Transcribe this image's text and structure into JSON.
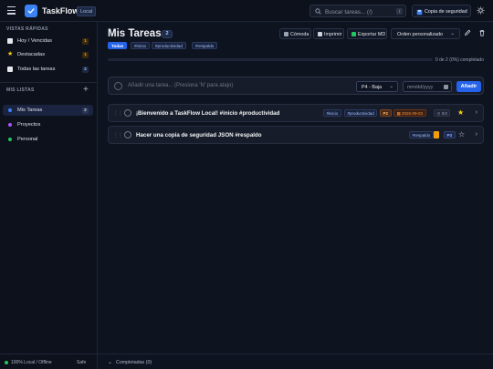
{
  "app": {
    "name": "TaskFlow",
    "badge": "Local"
  },
  "search": {
    "placeholder": "Buscar tareas... (/)",
    "shortcut": "/"
  },
  "header_actions": {
    "backup_label": "Copia de seguridad",
    "theme_icon": "sun-icon"
  },
  "sidebar": {
    "quick_views_title": "VISTAS RÁPIDAS",
    "quick_views": [
      {
        "label": "Hoy / Vencidas",
        "count": "1",
        "icon": "calendar-icon",
        "count_color": "#f59e0b"
      },
      {
        "label": "Destacadas",
        "count": "1",
        "icon": "star-icon",
        "count_color": "#f59e0b"
      },
      {
        "label": "Todas las tareas",
        "count": "2",
        "icon": "clipboard-icon",
        "count_color": "#3b82f6"
      }
    ],
    "lists_title": "MIS LISTAS",
    "lists": [
      {
        "label": "Mis Tareas",
        "count": "2",
        "color": "#3b82f6",
        "active": true
      },
      {
        "label": "Proyectos",
        "color": "#a855f7"
      },
      {
        "label": "Personal",
        "color": "#22c55e"
      }
    ],
    "footer_status": "100% Local / Offline",
    "footer_safe": "Safe"
  },
  "main": {
    "title": "Mis Tareas",
    "count": "2",
    "toolbar": {
      "density": "Cómoda",
      "print": "Imprimir",
      "export": "Exportar MD",
      "sort": "Orden personalizado"
    },
    "tags": [
      "Todas",
      "#inicio",
      "#productividad",
      "#respaldo"
    ],
    "progress": {
      "percent": 0,
      "text": "0 de 2 (0%) completado"
    },
    "add_task": {
      "placeholder": "Añadir una tarea... (Presiona 'N' para atajo)",
      "priority": "P4 - Baja",
      "date_placeholder": "mm/dd/yyyy",
      "add_label": "Añadir"
    },
    "tasks": [
      {
        "title": "¡Bienvenido a TaskFlow Local! #inicio #productividad",
        "tags": [
          "#inicio",
          "#productividad"
        ],
        "priority": "P2",
        "due": "2026-09-03",
        "subtasks": "0/2",
        "starred": true
      },
      {
        "title": "Hacer una copia de seguridad JSON #respaldo",
        "tags": [
          "#respaldo"
        ],
        "priority": "P3",
        "starred": false
      }
    ],
    "completed_label": "Completadas (0)"
  }
}
